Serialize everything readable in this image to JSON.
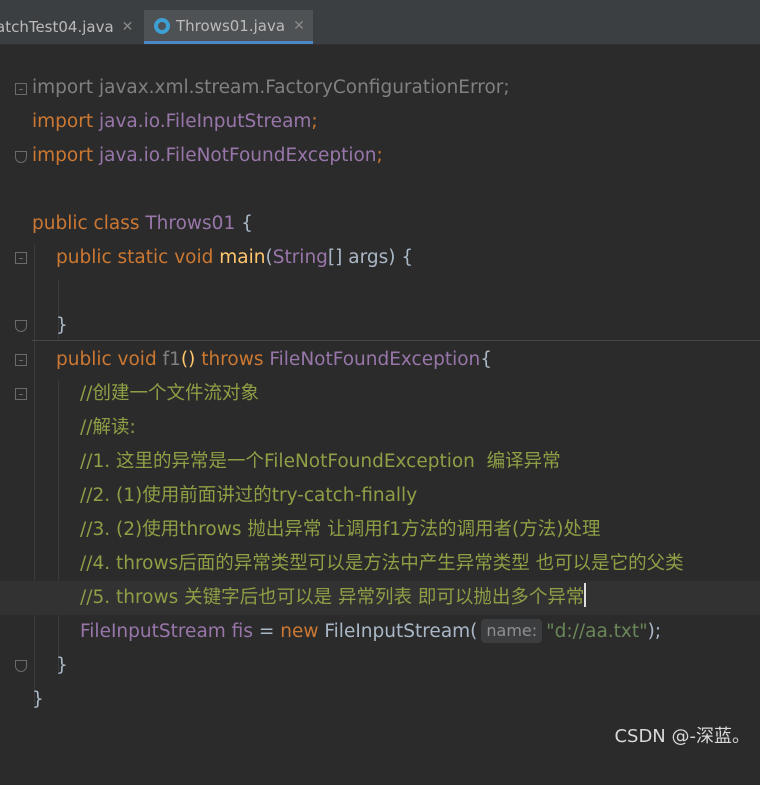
{
  "tabs": [
    {
      "label": "atchTest04.java",
      "active": false
    },
    {
      "label": "Throws01.java",
      "active": true
    }
  ],
  "lines": {
    "l1": {
      "a": "import javax.xml.stream.FactoryConfigurationError;"
    },
    "l2": {
      "kw": "import ",
      "pkg": "java.io.FileInputStream",
      "semi": ";"
    },
    "l3": {
      "kw": "import ",
      "pkg": "java.io.FileNotFoundException",
      "semi": ";"
    },
    "l5": {
      "kw": "public class ",
      "cls": "Throws01",
      "rest": " {"
    },
    "l6": {
      "kw": "public static void ",
      "fn": "main",
      "p1": "(",
      "cls": "String",
      "rest": "[] args) {"
    },
    "l8": {
      "rest": "}"
    },
    "l9": {
      "kw": "public void ",
      "fn": "f1",
      "p": "() ",
      "kw2": "throws ",
      "cls": "FileNotFoundException",
      "rest": "{"
    },
    "l10": {
      "c": "//创建一个文件流对象"
    },
    "l11": {
      "c": "//解读:"
    },
    "l12": {
      "c": "//1. 这里的异常是一个FileNotFoundException  编译异常"
    },
    "l13": {
      "c": "//2. (1)使用前面讲过的try-catch-finally"
    },
    "l14": {
      "c": "//3. (2)使用throws 抛出异常 让调用f1方法的调用者(方法)处理"
    },
    "l15": {
      "c": "//4. throws后面的异常类型可以是方法中产生异常类型 也可以是它的父类"
    },
    "l16": {
      "c": "//5. throws 关键字后也可以是 异常列表 即可以抛出多个异常"
    },
    "l17": {
      "cls": "FileInputStream",
      "var": " fis ",
      "eq": "= ",
      "kw": "new ",
      "ctor": "FileInputStream(",
      "hint": "name:",
      "str": "\"d://aa.txt\"",
      "rest": ");"
    },
    "l18": {
      "rest": "}"
    },
    "l19": {
      "rest": "}"
    }
  },
  "watermark": "CSDN @-深蓝。"
}
